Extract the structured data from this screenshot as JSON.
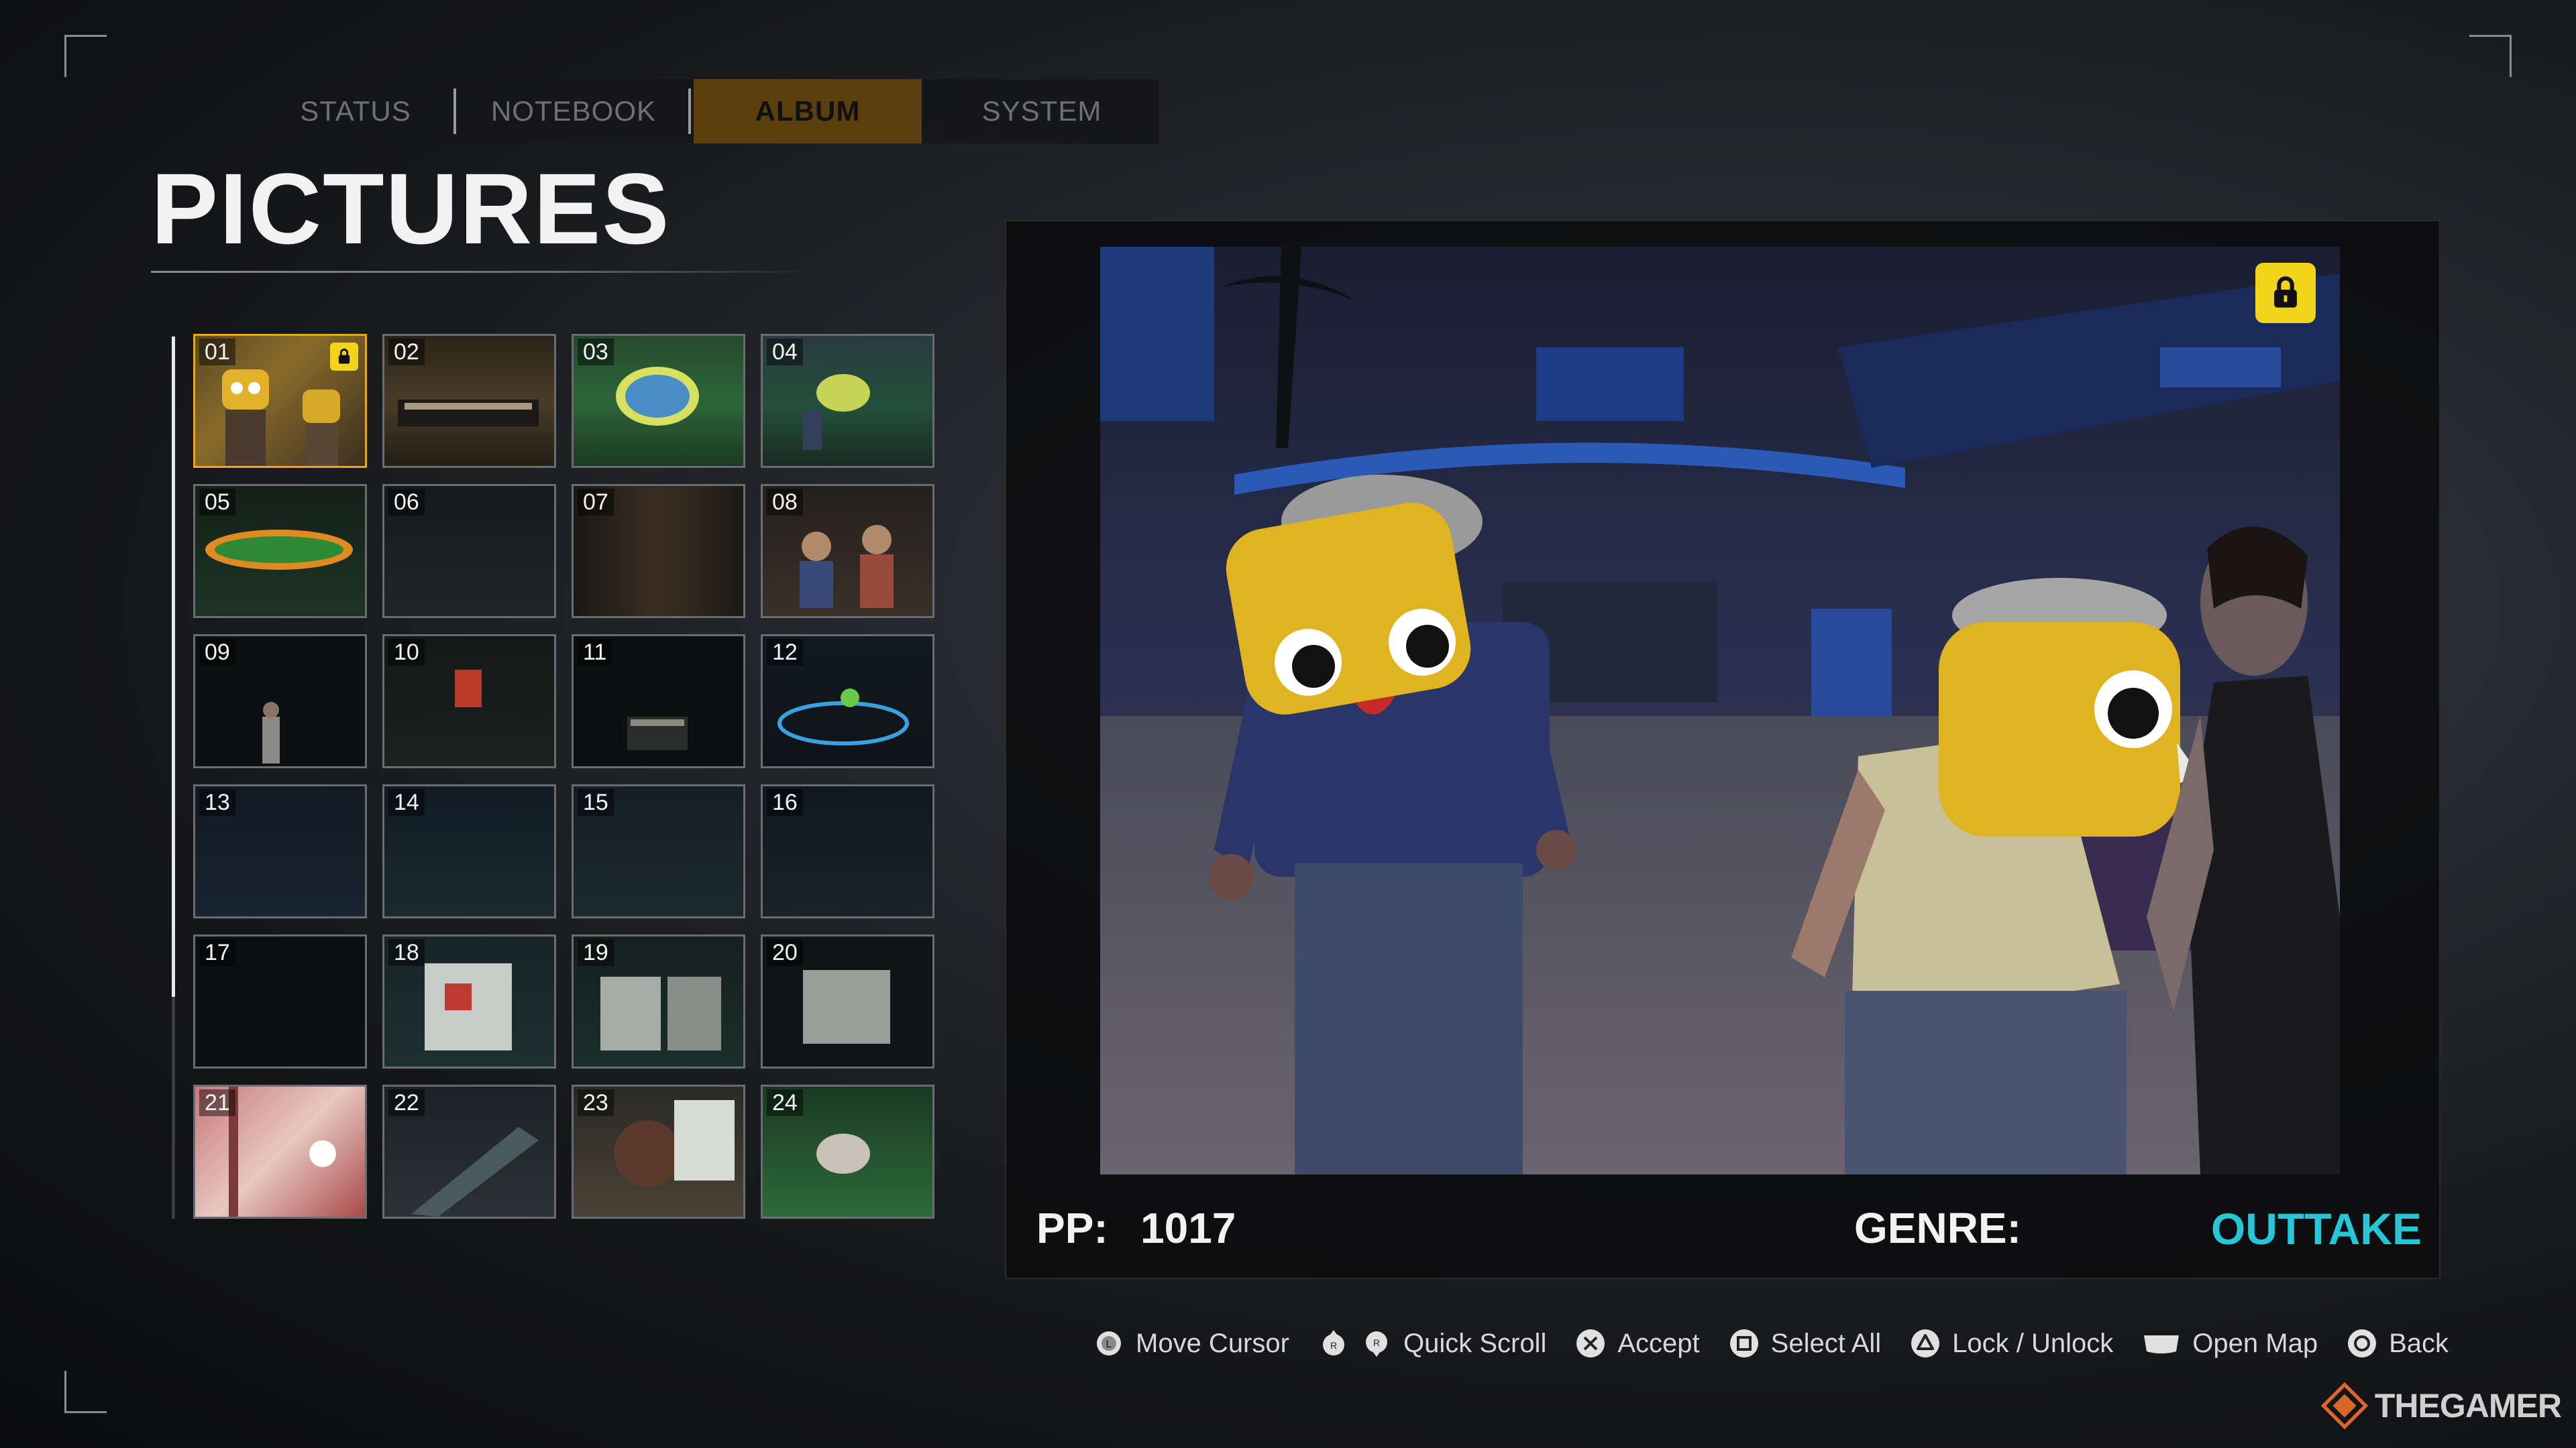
{
  "tabs": [
    {
      "label": "STATUS",
      "active": false
    },
    {
      "label": "NOTEBOOK",
      "active": false
    },
    {
      "label": "ALBUM",
      "active": true
    },
    {
      "label": "SYSTEM",
      "active": false
    }
  ],
  "page_title": "PICTURES",
  "thumbnails": [
    {
      "num": "01",
      "locked": true,
      "selected": true
    },
    {
      "num": "02"
    },
    {
      "num": "03"
    },
    {
      "num": "04"
    },
    {
      "num": "05"
    },
    {
      "num": "06"
    },
    {
      "num": "07"
    },
    {
      "num": "08"
    },
    {
      "num": "09"
    },
    {
      "num": "10"
    },
    {
      "num": "11"
    },
    {
      "num": "12"
    },
    {
      "num": "13"
    },
    {
      "num": "14"
    },
    {
      "num": "15"
    },
    {
      "num": "16"
    },
    {
      "num": "17"
    },
    {
      "num": "18"
    },
    {
      "num": "19"
    },
    {
      "num": "20"
    },
    {
      "num": "21"
    },
    {
      "num": "22"
    },
    {
      "num": "23"
    },
    {
      "num": "24"
    }
  ],
  "preview": {
    "pp_label": "PP:",
    "pp_value": "1017",
    "genre_label": "GENRE:",
    "genre_value": "OUTTAKE",
    "locked": true
  },
  "hints": [
    {
      "label": "Move Cursor",
      "icon": "left-stick-icon"
    },
    {
      "label": "Quick Scroll",
      "icon": "r-stick-icons"
    },
    {
      "label": "Accept",
      "icon": "cross-button-icon"
    },
    {
      "label": "Select All",
      "icon": "square-button-icon"
    },
    {
      "label": "Lock / Unlock",
      "icon": "triangle-button-icon"
    },
    {
      "label": "Open Map",
      "icon": "touchpad-icon"
    },
    {
      "label": "Back",
      "icon": "circle-button-icon"
    }
  ],
  "watermark": "THEGAMER",
  "colors": {
    "accent_tab": "#5c3f0e",
    "selected_border": "#e6a91e",
    "lock_yellow": "#f1d31a",
    "genre_cyan": "#27c6d6"
  }
}
